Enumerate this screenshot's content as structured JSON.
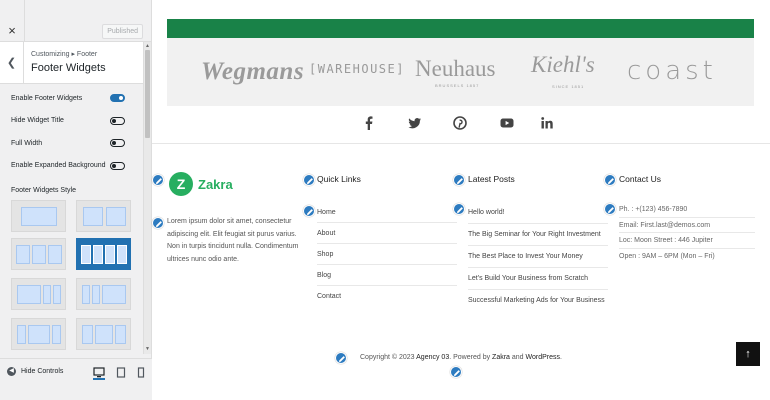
{
  "panel": {
    "close_label": "×",
    "published_label": "Published",
    "breadcrumb": "Customizing ▸ Footer",
    "title": "Footer Widgets",
    "toggles": [
      {
        "label": "Enable Footer Widgets",
        "on": true
      },
      {
        "label": "Hide Widget Title",
        "on": false
      },
      {
        "label": "Full Width",
        "on": false
      },
      {
        "label": "Enable Expanded Background",
        "on": false
      }
    ],
    "style_label": "Footer Widgets Style",
    "hide_controls_label": "Hide Controls"
  },
  "brands": {
    "wegmans": "Wegmans",
    "warehouse": "[WAREHOUSE]",
    "neuhaus": "Neuhaus",
    "neuhaus_sub": "BRUSSELS 1857",
    "kiehls": "Kiehl's",
    "kiehls_sub": "SINCE 1851",
    "coast": "coast"
  },
  "footer": {
    "logo_mark": "Z",
    "logo_name": "Zakra",
    "about": "Lorem ipsum dolor sit amet, consectetur adipiscing elit. Elit feugiat sit purus varius. Non in turpis tincidunt nulla. Condimentum ultrices nunc odio ante.",
    "quick_links_title": "Quick Links",
    "quick_links": [
      "Home",
      "About",
      "Shop",
      "Blog",
      "Contact"
    ],
    "latest_posts_title": "Latest Posts",
    "latest_posts": [
      "Hello world!",
      "The Big Seminar for Your Right Investment",
      "The Best Place to Invest Your Money",
      "Let's Build Your Business from Scratch",
      "Successful Marketing Ads for Your Business"
    ],
    "contact_title": "Contact Us",
    "contact": [
      "Ph. : +(123) 456-7890",
      "Email: First.last@demos.com",
      "Loc: Moon Street : 446 Jupiter",
      "Open : 9AM – 6PM (Mon – Fri)"
    ],
    "copyright_pre": "Copyright © 2023 ",
    "copyright_site": "Agency 03",
    "copyright_mid": ". Powered by ",
    "copyright_theme": "Zakra",
    "copyright_and": " and ",
    "copyright_wp": "WordPress",
    "copyright_end": "."
  },
  "colors": {
    "accent": "#2271b1",
    "brand_green": "#198248",
    "zakra_green": "#27ae60"
  }
}
